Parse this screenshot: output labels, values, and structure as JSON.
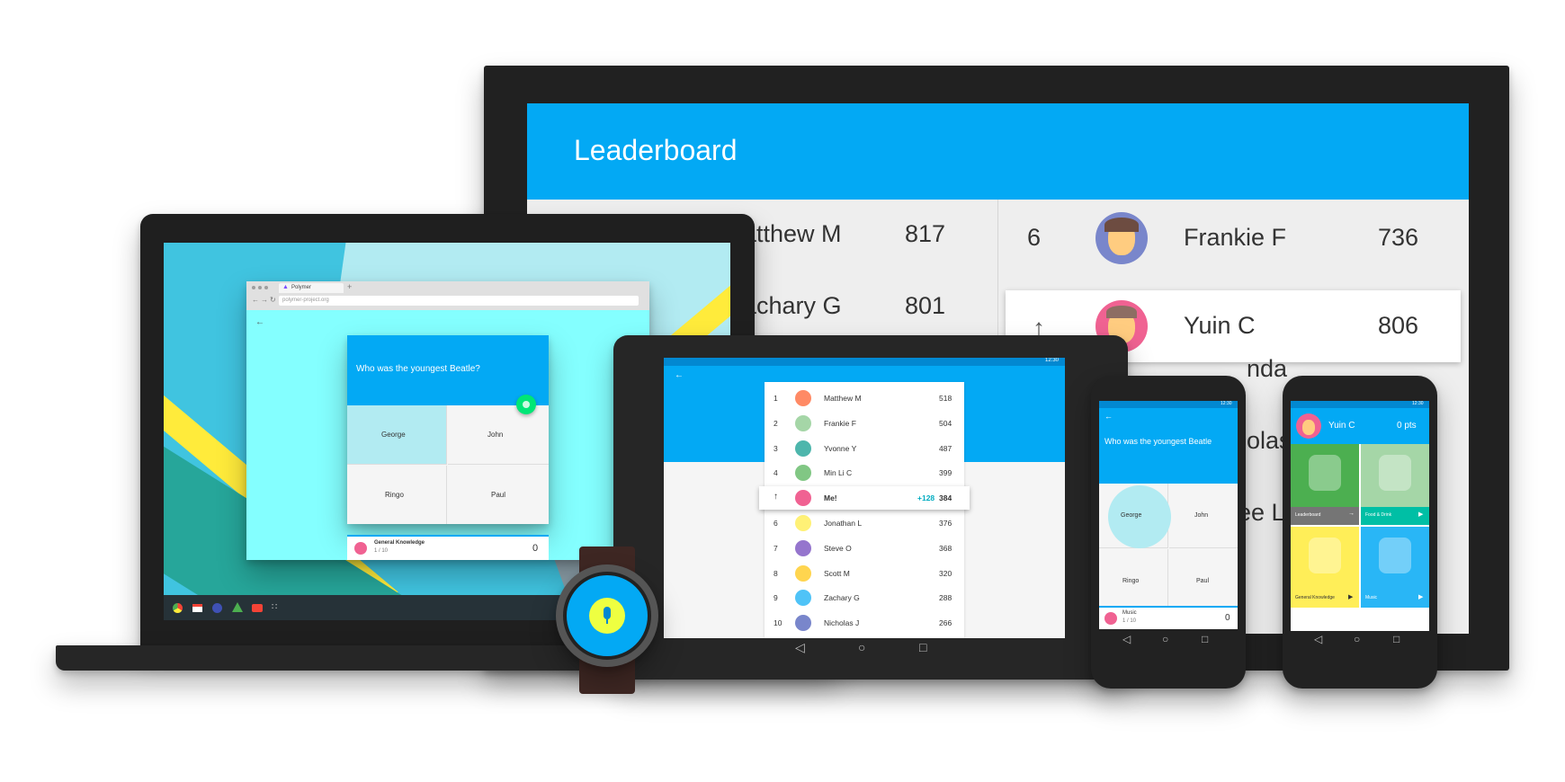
{
  "monitor": {
    "title": "Leaderboard",
    "left_rows": [
      {
        "name": "atthew M",
        "score": "817"
      },
      {
        "name": "achary G",
        "score": "801"
      }
    ],
    "right_rows": [
      {
        "rank": "6",
        "name": "Frankie F",
        "score": "736"
      },
      {
        "rank": "",
        "name": "Yuin C",
        "score": "806",
        "highlight": true
      },
      {
        "rank": "",
        "name": "nda",
        "score": ""
      },
      {
        "rank": "",
        "name": "olas",
        "score": ""
      },
      {
        "rank": "",
        "name": "ee L",
        "score": ""
      }
    ]
  },
  "laptop": {
    "tab_title": "Polymer",
    "url": "polymer-project.org",
    "quiz_question": "Who was the youngest Beatle?",
    "answers": [
      "George",
      "John",
      "Ringo",
      "Paul"
    ],
    "category": "General Knowledge",
    "progress": "1 / 10",
    "points": "0",
    "shelf_apps": [
      "chrome-icon",
      "gmail-icon",
      "google-plus-icon",
      "drive-icon",
      "youtube-icon",
      "apps-grid-icon"
    ]
  },
  "tablet": {
    "status_time": "12:30",
    "rows": [
      {
        "rank": "1",
        "name": "Matthew M",
        "score": "518",
        "avatar": "#ff8a65"
      },
      {
        "rank": "2",
        "name": "Frankie F",
        "score": "504",
        "avatar": "#a5d6a7"
      },
      {
        "rank": "3",
        "name": "Yvonne Y",
        "score": "487",
        "avatar": "#4db6ac"
      },
      {
        "rank": "4",
        "name": "Min Li C",
        "score": "399",
        "avatar": "#81c784"
      },
      {
        "rank": "",
        "name": "Me!",
        "score": "384",
        "delta": "+128",
        "me": true,
        "avatar": "#f06292"
      },
      {
        "rank": "6",
        "name": "Jonathan L",
        "score": "376",
        "avatar": "#fff176"
      },
      {
        "rank": "7",
        "name": "Steve O",
        "score": "368",
        "avatar": "#9575cd"
      },
      {
        "rank": "8",
        "name": "Scott M",
        "score": "320",
        "avatar": "#ffd54f"
      },
      {
        "rank": "9",
        "name": "Zachary G",
        "score": "288",
        "avatar": "#4fc3f7"
      },
      {
        "rank": "10",
        "name": "Nicholas J",
        "score": "266",
        "avatar": "#7986cb"
      }
    ]
  },
  "phone1": {
    "status_time": "12:30",
    "question": "Who was the youngest Beatle",
    "answers": [
      "George",
      "John",
      "Ringo",
      "Paul"
    ],
    "category": "Music",
    "progress": "1 / 10",
    "points": "0"
  },
  "phone2": {
    "status_time": "12:30",
    "user": "Yuin C",
    "points": "0 pts",
    "tiles": [
      {
        "label": "Leaderboard",
        "bg": "#4caf50",
        "bar": "#757575",
        "icon": "trophy-icon"
      },
      {
        "label": "Food & Drink",
        "bg": "#a5d6a7",
        "bar": "#00bfa5",
        "icon": "food-icon"
      },
      {
        "label": "General Knowledge",
        "bg": "#ffee58",
        "bar": "#ffee58",
        "icon": "books-icon"
      },
      {
        "label": "Music",
        "bg": "#29b6f6",
        "bar": "#29b6f6",
        "icon": "vinyl-icon"
      }
    ]
  }
}
